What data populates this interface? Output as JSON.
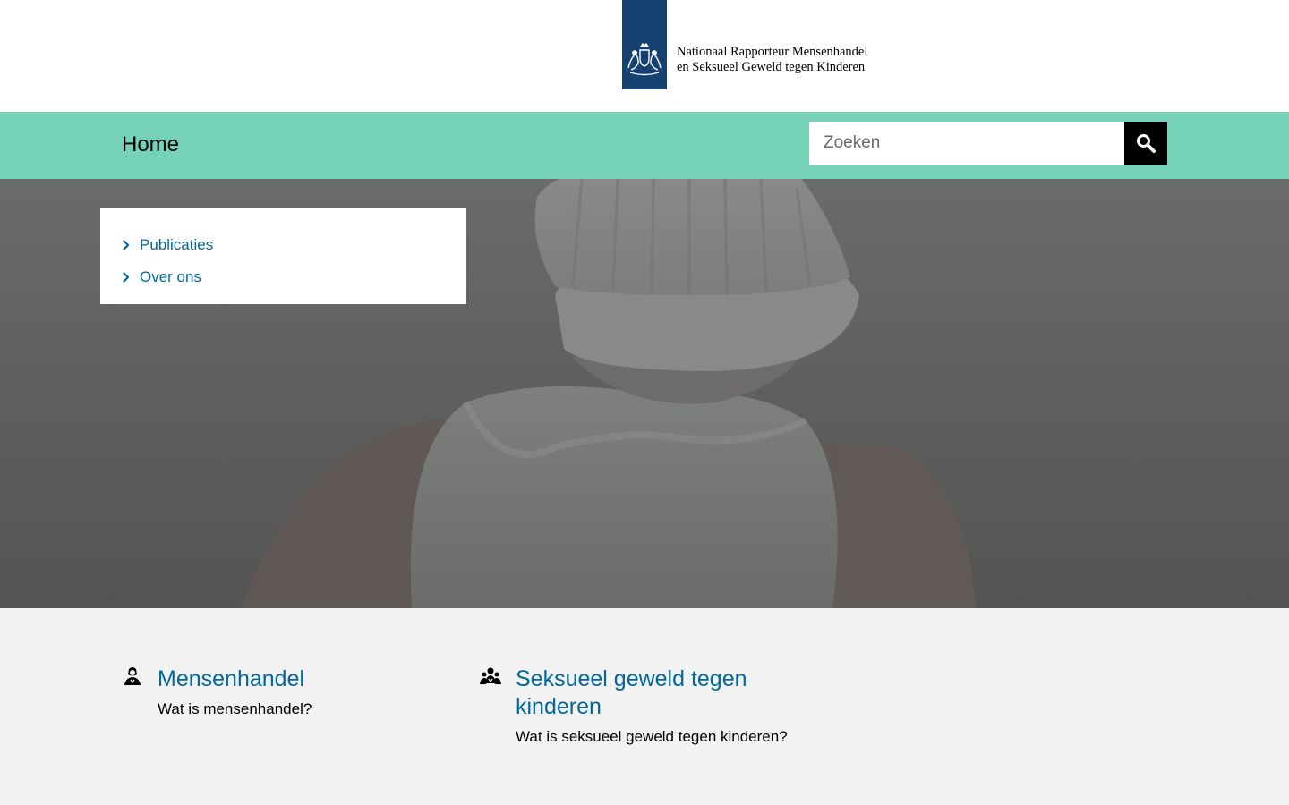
{
  "header": {
    "logo_icon": "royal-coat-of-arms-icon",
    "logo_line1": "Nationaal Rapporteur Mensenhandel",
    "logo_line2": "en Seksueel Geweld tegen Kinderen",
    "brand_color": "#154273"
  },
  "nav": {
    "home_label": "Home",
    "bar_color": "#76d2b6",
    "search_placeholder": "Zoeken",
    "search_icon": "search-icon"
  },
  "hero": {
    "menu_items": [
      {
        "label": "Publicaties",
        "icon": "chevron-right-icon"
      },
      {
        "label": "Over ons",
        "icon": "chevron-right-icon"
      }
    ]
  },
  "topics": [
    {
      "icon": "woman-figure-icon",
      "title": "Mensenhandel",
      "description": "Wat is mensenhandel?"
    },
    {
      "icon": "group-figures-icon",
      "title": "Seksueel geweld tegen kinderen",
      "description": "Wat is seksueel geweld tegen kinderen?"
    }
  ],
  "colors": {
    "link": "#01689b",
    "background": "#f2f2f2"
  }
}
